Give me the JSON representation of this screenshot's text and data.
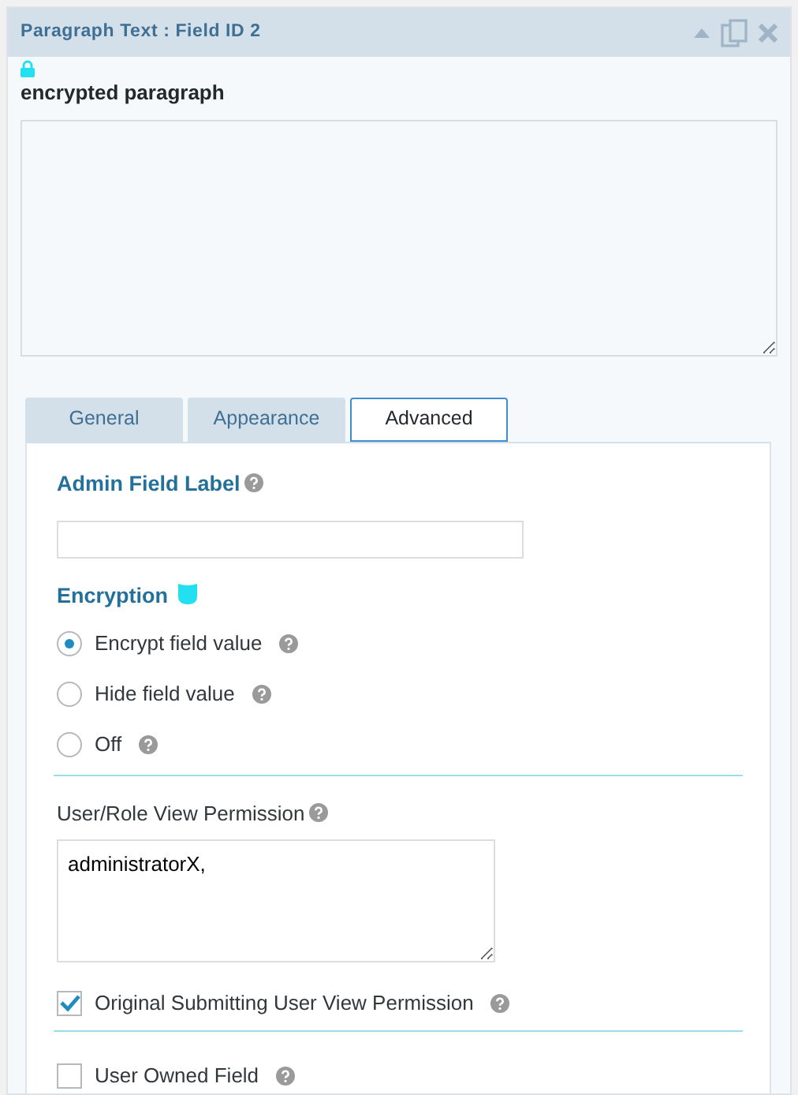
{
  "panel": {
    "title": "Paragraph Text : Field ID 2"
  },
  "field": {
    "label": "encrypted paragraph"
  },
  "tabs": [
    {
      "label": "General",
      "selected": false
    },
    {
      "label": "Appearance",
      "selected": false
    },
    {
      "label": "Advanced",
      "selected": true
    }
  ],
  "admin_label": {
    "label": "Admin Field Label"
  },
  "encryption": {
    "label": "Encryption",
    "options": [
      {
        "label": "Encrypt field value",
        "selected": true
      },
      {
        "label": "Hide field value",
        "selected": false
      },
      {
        "label": "Off",
        "selected": false
      }
    ]
  },
  "permission": {
    "label": "User/Role View Permission",
    "value": "administratorX,"
  },
  "checkboxes": [
    {
      "label": "Original Submitting User View Permission",
      "checked": true
    },
    {
      "label": "User Owned Field",
      "checked": false
    }
  ]
}
